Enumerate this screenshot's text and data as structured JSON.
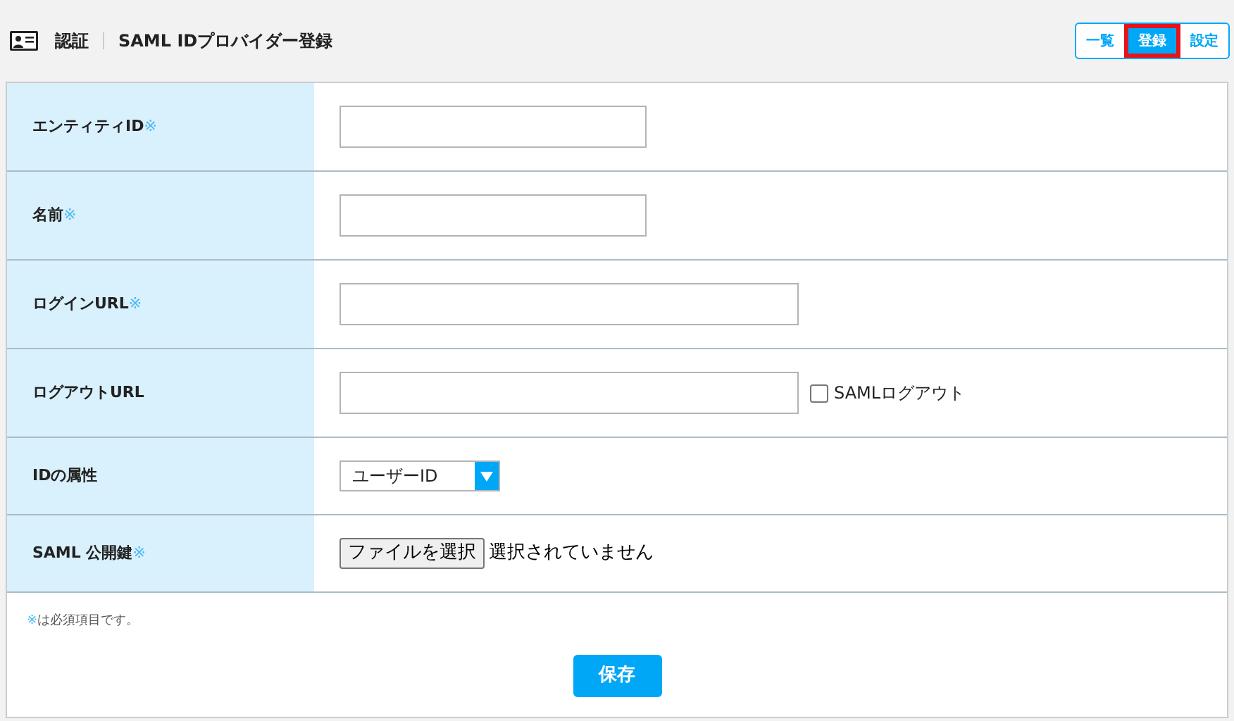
{
  "header": {
    "section": "認証",
    "title": "SAML IDプロバイダー登録"
  },
  "nav_tabs": [
    {
      "label": "一覧",
      "selected": false
    },
    {
      "label": "登録",
      "selected": true
    },
    {
      "label": "設定",
      "selected": false
    }
  ],
  "form_rows": [
    {
      "label": "エンティティID",
      "required_mark": "※",
      "kind": "short_text"
    },
    {
      "label": "名前",
      "required_mark": "※",
      "kind": "short_text"
    },
    {
      "label": "ログインURL",
      "required_mark": "※",
      "kind": "long_text"
    },
    {
      "label": "ログアウトURL",
      "kind": "long_text_checkbox",
      "checkbox": {
        "label": "SAMLログアウト",
        "checked": false
      }
    },
    {
      "label": "IDの属性",
      "kind": "select",
      "value": "ユーザーID"
    },
    {
      "label": "SAML 公開鍵",
      "required_mark": "※",
      "kind": "file",
      "button": "ファイルを選択",
      "status": "選択されていません"
    }
  ],
  "note": {
    "mark": "※",
    "text": "は必須項目です。"
  },
  "save_button": "保存"
}
